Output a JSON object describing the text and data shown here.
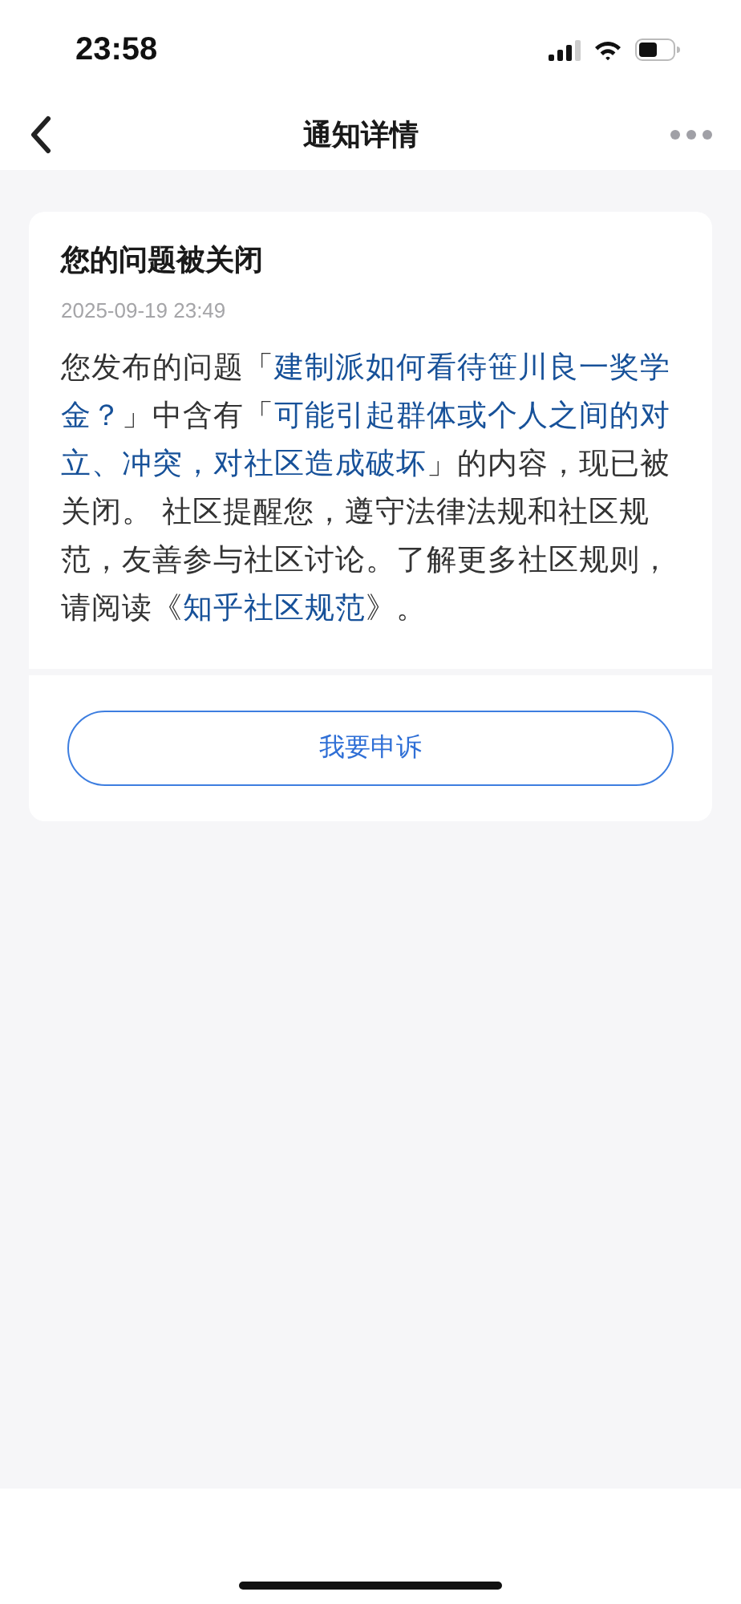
{
  "status_bar": {
    "time": "23:58"
  },
  "nav": {
    "title": "通知详情"
  },
  "notice": {
    "title": "您的问题被关闭",
    "date": "2025-09-19 23:49",
    "body": [
      {
        "kind": "text",
        "text": "您发布的问题「"
      },
      {
        "kind": "link",
        "text": "建制派如何看待笹川良一奖学金？"
      },
      {
        "kind": "text",
        "text": "」中含有「"
      },
      {
        "kind": "link",
        "text": "可能引起群体或个人之间的对立、冲突，对社区造成破坏"
      },
      {
        "kind": "text",
        "text": "」的内容，现已被关闭。 社区提醒您，遵守法律法规和社区规范，友善参与社区讨论。了解更多社区规则，请阅读《"
      },
      {
        "kind": "link",
        "text": "知乎社区规范"
      },
      {
        "kind": "text",
        "text": "》。"
      }
    ]
  },
  "appeal_button": "我要申诉"
}
